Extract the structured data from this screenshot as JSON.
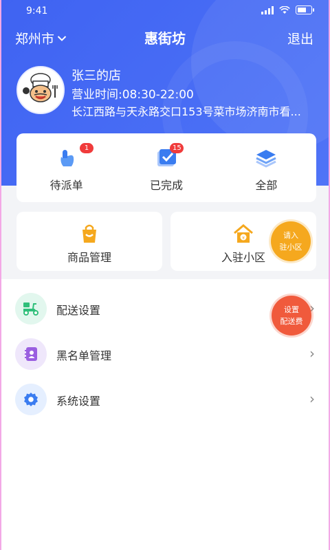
{
  "status": {
    "time": "9:41"
  },
  "nav": {
    "city": "郑州市",
    "title": "惠街坊",
    "logout": "退出"
  },
  "store": {
    "name": "张三的店",
    "hours": "营业时间:08:30-22:00",
    "address": "长江西路与天永路交口153号菜市场济南市看..."
  },
  "orders": [
    {
      "label": "待派单",
      "badge": "1",
      "icon": "pointer-hand-icon"
    },
    {
      "label": "已完成",
      "badge": "15",
      "icon": "checkbox-icon"
    },
    {
      "label": "全部",
      "badge": "",
      "icon": "layers-icon"
    }
  ],
  "shortcuts": [
    {
      "label": "商品管理",
      "icon": "shopping-bag-icon"
    },
    {
      "label": "入驻小区",
      "icon": "house-icon"
    }
  ],
  "bubbles": {
    "join": {
      "line1": "请入",
      "line2": "驻小区"
    },
    "fee": {
      "line1": "设置",
      "line2": "配送费"
    }
  },
  "menu": [
    {
      "label": "配送设置",
      "icon": "delivery-scooter-icon"
    },
    {
      "label": "黑名单管理",
      "icon": "contact-book-icon"
    },
    {
      "label": "系统设置",
      "icon": "gear-icon"
    }
  ],
  "colors": {
    "header": "#4a6cf5",
    "badge": "#f03b3b",
    "orange": "#f5a81e",
    "red": "#f05a3c"
  }
}
